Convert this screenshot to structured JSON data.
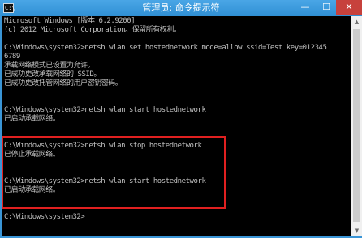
{
  "window": {
    "icon_text": "C:\\",
    "title": "管理员: 命令提示符",
    "minimize_glyph": "—",
    "maximize_glyph": "☐",
    "close_glyph": "✕"
  },
  "console": {
    "lines": [
      "Microsoft Windows [版本 6.2.9200]",
      "(c) 2012 Microsoft Corporation。保留所有权利。",
      "",
      "C:\\Windows\\system32>netsh wlan set hostednetwork mode=allow ssid=Test key=012345",
      "6789",
      "承载网络模式已设置为允许。",
      "已成功更改承载网络的 SSID。",
      "已成功更改托管网络的用户密钥密码。",
      "",
      "",
      "C:\\Windows\\system32>netsh wlan start hostednetwork",
      "已启动承载网络。",
      "",
      "",
      "C:\\Windows\\system32>netsh wlan stop hostednetwork",
      "已停止承载网络。",
      "",
      "",
      "C:\\Windows\\system32>netsh wlan start hostednetwork",
      "已启动承载网络。",
      "",
      "",
      "C:\\Windows\\system32>"
    ]
  },
  "scrollbar": {
    "up_glyph": "▲",
    "down_glyph": "▼"
  },
  "colors": {
    "console_bg": "#000000",
    "console_text": "#c0c0c0",
    "titlebar": "#3a95d6",
    "highlight_border": "#e02020",
    "close_button": "#c7413c"
  }
}
